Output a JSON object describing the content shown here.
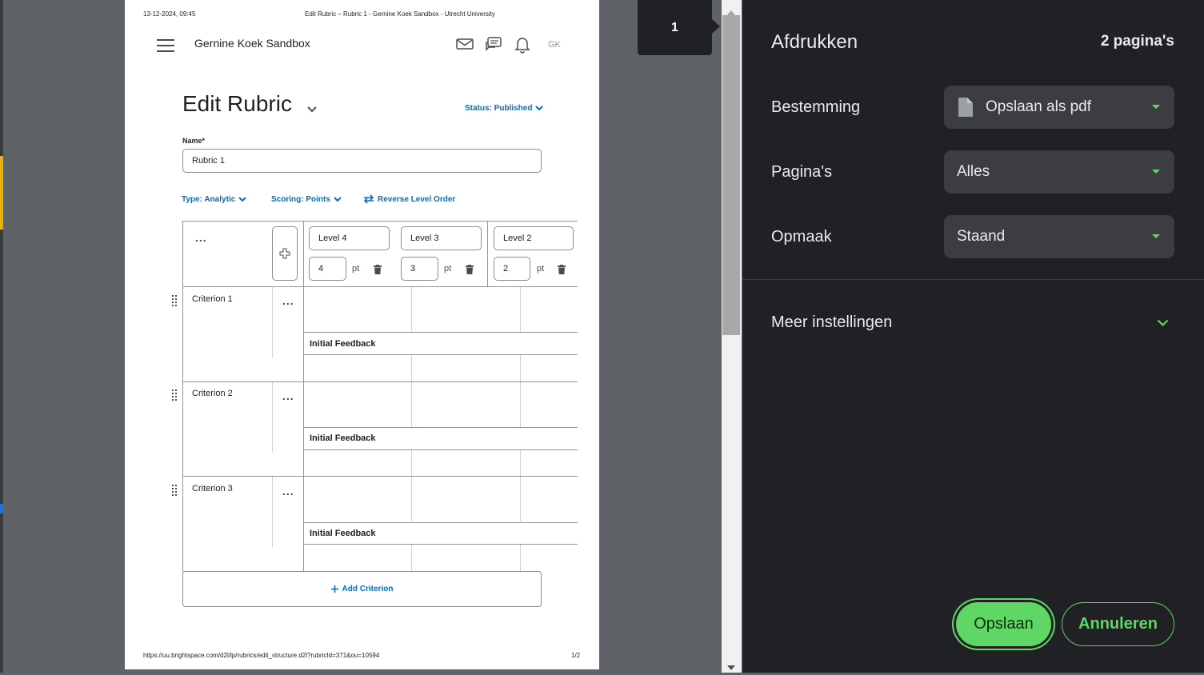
{
  "header": {
    "datetime": "13-12-2024, 09:45",
    "doc_title": "Edit Rubric – Rubric 1 - Gernine Koek Sandbox - Utrecht University"
  },
  "nav": {
    "org_name": "Gernine Koek Sandbox",
    "user_initials": "GK",
    "icons": [
      "menu-icon",
      "mail-icon",
      "chat-icon",
      "bell-icon"
    ]
  },
  "rubric": {
    "page_title": "Edit Rubric",
    "status": "Status: Published",
    "name_label": "Name*",
    "name_value": "Rubric 1",
    "type": "Type: Analytic",
    "scoring": "Scoring: Points",
    "reverse": "Reverse Level Order",
    "pt_unit": "pt",
    "levels": [
      {
        "name": "Level 4",
        "points": "4"
      },
      {
        "name": "Level 3",
        "points": "3"
      },
      {
        "name": "Level 2",
        "points": "2"
      }
    ],
    "criteria": [
      {
        "name": "Criterion 1",
        "feedback_label": "Initial Feedback"
      },
      {
        "name": "Criterion 2",
        "feedback_label": "Initial Feedback"
      },
      {
        "name": "Criterion 3",
        "feedback_label": "Initial Feedback"
      }
    ],
    "add_criterion": "Add Criterion",
    "more_symbol": "..."
  },
  "footer": {
    "url": "https://uu.brightspace.com/d2l/lp/rubrics/edit_structure.d2l?rubricId=371&ou=10594",
    "page_num": "1/2"
  },
  "preview": {
    "current_page": "1"
  },
  "print_panel": {
    "title": "Afdrukken",
    "page_count": "2 pagina's",
    "destination_label": "Bestemming",
    "destination_value": "Opslaan als pdf",
    "pages_label": "Pagina's",
    "pages_value": "Alles",
    "layout_label": "Opmaak",
    "layout_value": "Staand",
    "more_settings": "Meer instellingen",
    "save_button": "Opslaan",
    "cancel_button": "Annuleren",
    "accent_color": "#5ed764"
  }
}
